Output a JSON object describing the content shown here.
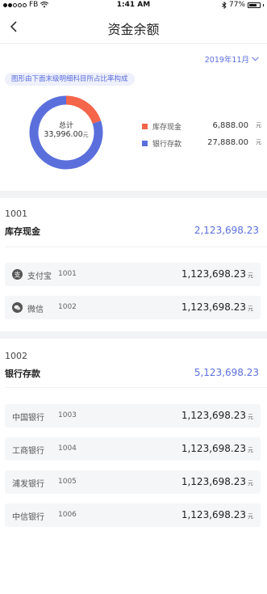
{
  "status_bar": {
    "carrier": "FB",
    "time": "1:41 AM",
    "battery": "77%",
    "battery_level": 0.77
  },
  "nav": {
    "title": "资金余额"
  },
  "filter": {
    "month": "2019年11月"
  },
  "hint": "图形由下面末级明细科目所占比率构成",
  "summary": {
    "total_label": "总计",
    "total_value": "33,996.00",
    "unit": "元",
    "legend": [
      {
        "name": "库存现金",
        "value": "6,888.00",
        "unit": "元",
        "color": "#f4654a",
        "share": 6888.0
      },
      {
        "name": "银行存款",
        "value": "27,888.00",
        "unit": "元",
        "color": "#5b6fdc",
        "share": 27888.0
      }
    ]
  },
  "groups": [
    {
      "code": "1001",
      "name": "库存现金",
      "amount": "2,123,698.23",
      "items": [
        {
          "name": "支付宝",
          "code": "1001",
          "amount": "1,123,698.23",
          "unit": "元",
          "icon": "alipay-icon"
        },
        {
          "name": "微信",
          "code": "1002",
          "amount": "1,123,698.23",
          "unit": "元",
          "icon": "wechat-icon"
        }
      ]
    },
    {
      "code": "1002",
      "name": "银行存款",
      "amount": "5,123,698.23",
      "items": [
        {
          "name": "中国银行",
          "code": "1003",
          "amount": "1,123,698.23",
          "unit": "元"
        },
        {
          "name": "工商银行",
          "code": "1004",
          "amount": "1,123,698.23",
          "unit": "元"
        },
        {
          "name": "浦发银行",
          "code": "1005",
          "amount": "1,123,698.23",
          "unit": "元"
        },
        {
          "name": "中信银行",
          "code": "1006",
          "amount": "1,123,698.23",
          "unit": "元"
        }
      ]
    }
  ]
}
